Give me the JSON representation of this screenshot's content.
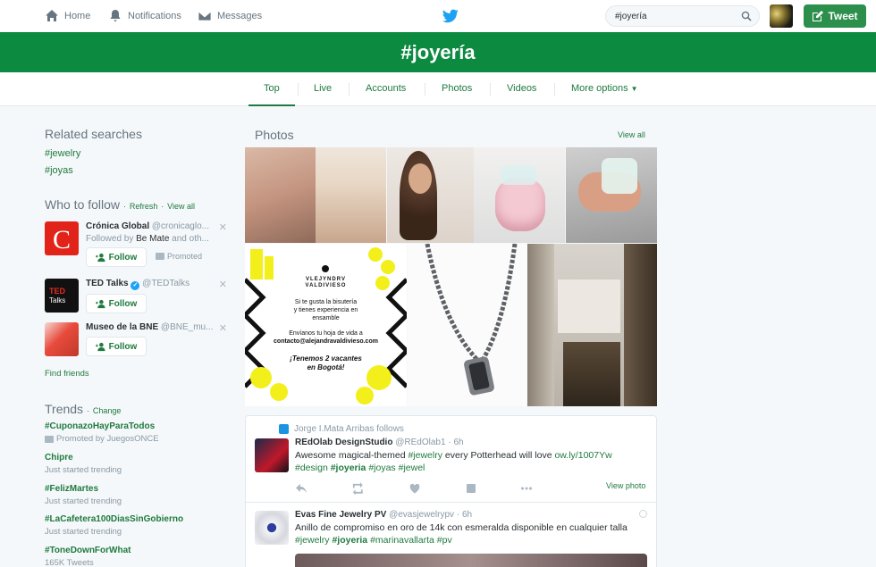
{
  "nav": {
    "home": "Home",
    "notifications": "Notifications",
    "messages": "Messages",
    "search_value": "#joyería",
    "tweet": "Tweet"
  },
  "banner": {
    "hashtag": "#joyería"
  },
  "tabs": [
    {
      "label": "Top"
    },
    {
      "label": "Live"
    },
    {
      "label": "Accounts"
    },
    {
      "label": "Photos"
    },
    {
      "label": "Videos"
    },
    {
      "label": "More options"
    }
  ],
  "related": {
    "title": "Related searches",
    "items": [
      "#jewelry",
      "#joyas"
    ]
  },
  "who_to_follow": {
    "title": "Who to follow",
    "refresh": "Refresh",
    "view_all": "View all",
    "sep": "·",
    "follow_label": "Follow",
    "promoted_label": "Promoted",
    "accounts": [
      {
        "name": "Crónica Global",
        "handle": "@cronicaglo...",
        "followed_prefix": "Followed by",
        "followed_by": "Be Mate",
        "followed_suffix": "and oth..."
      },
      {
        "name": "TED Talks",
        "handle": "@TEDTalks"
      },
      {
        "name": "Museo de la BNE",
        "handle": "@BNE_mu..."
      }
    ],
    "find_friends": "Find friends"
  },
  "trends": {
    "title": "Trends",
    "change": "Change",
    "sep": "·",
    "items": [
      {
        "name": "#CuponazoHayParaTodos",
        "sub": "Promoted by JuegosONCE"
      },
      {
        "name": "Chipre",
        "sub": "Just started trending"
      },
      {
        "name": "#FelizMartes",
        "sub": "Just started trending"
      },
      {
        "name": "#LaCafetera100DiasSinGobierno",
        "sub": "Just started trending"
      },
      {
        "name": "#ToneDownForWhat",
        "sub": "165K Tweets"
      }
    ]
  },
  "photos": {
    "title": "Photos",
    "view_all": "View all",
    "ad": {
      "brand_line1": "VLEJYNDRV",
      "brand_line2": "VALDIVIESO",
      "line1": "Si te gusta la bisutería",
      "line2": "y tienes experiencia en",
      "line3": "ensamble",
      "line4": "Envíanos tu hoja de vida a",
      "email": "contacto@alejandravaldivieso.com",
      "line5": "¡Tenemos 2 vacantes",
      "line6": "en Bogotá!"
    }
  },
  "tweets": [
    {
      "context": "Jorge I.Mata Arribas follows",
      "name": "REdOlab DesignStudio",
      "handle": "@REdOlab1",
      "time": "6h",
      "text": "Awesome magical-themed",
      "tag1": "#jewelry",
      "text2": "every Potterhead will love",
      "link": "ow.ly/1007Yw",
      "tags": [
        "#design",
        "#joyeria",
        "#joyas",
        "#jewel"
      ],
      "view_photo": "View photo"
    },
    {
      "name": "Evas Fine Jewelry PV",
      "handle": "@evasjewelrypv",
      "time": "6h",
      "text": "Anillo de compromiso en oro de 14k con esmeralda disponible en cualquier talla",
      "tags": [
        "#jewelry",
        "#joyeria",
        "#marinavallarta",
        "#pv"
      ]
    }
  ],
  "colors": {
    "accent": "#0c8a40",
    "link": "#1f7a3f",
    "muted": "#8899a6"
  }
}
